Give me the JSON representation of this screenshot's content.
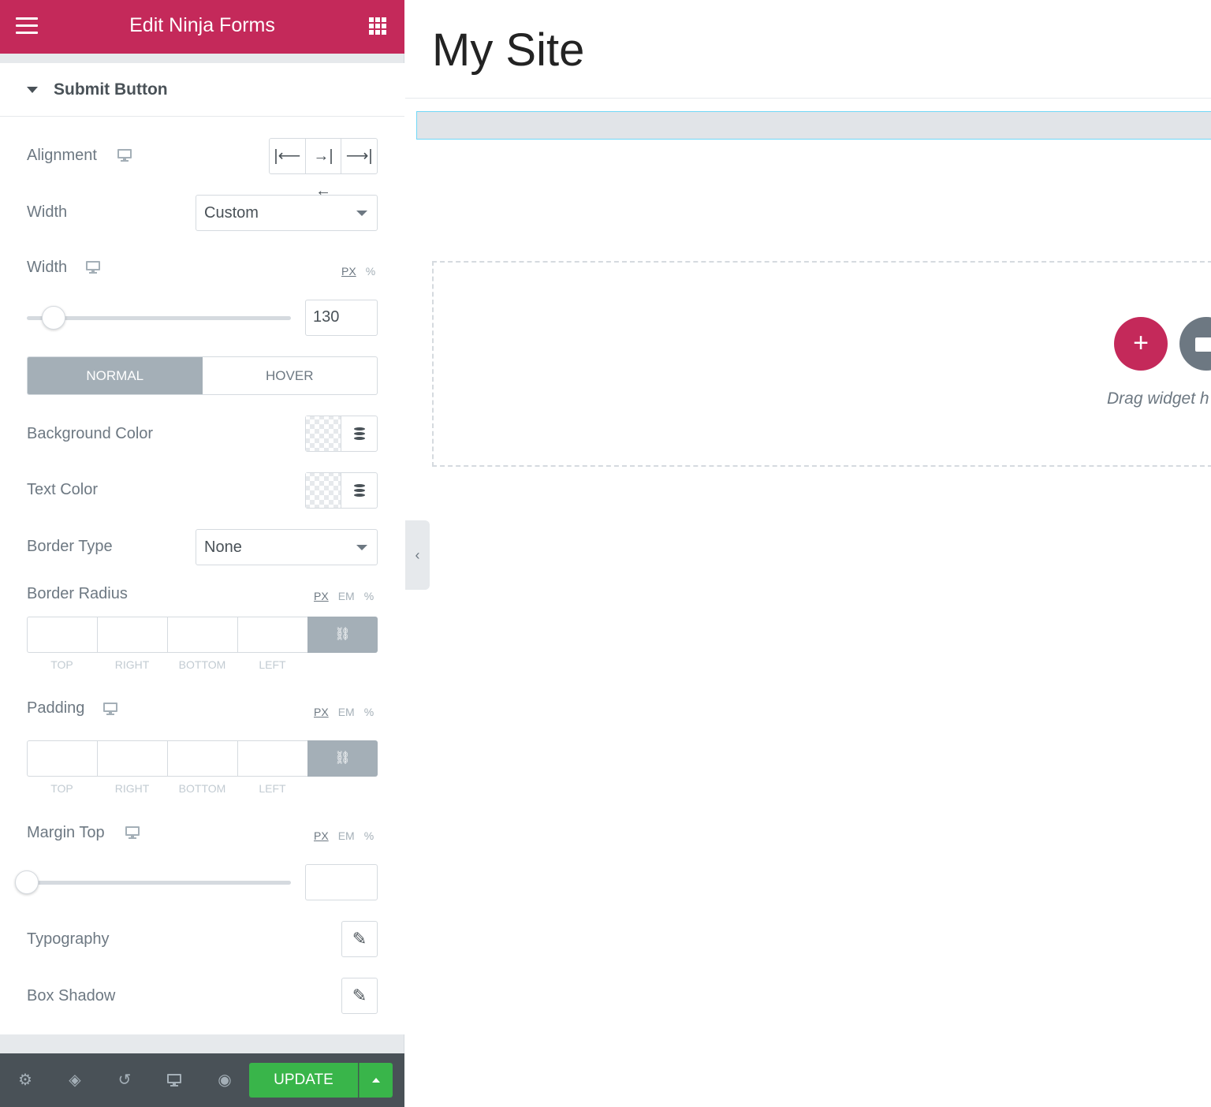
{
  "header": {
    "title": "Edit Ninja Forms"
  },
  "section": {
    "title": "Submit Button"
  },
  "controls": {
    "alignment": {
      "label": "Alignment"
    },
    "width_type": {
      "label": "Width",
      "value": "Custom"
    },
    "width_size": {
      "label": "Width",
      "units": [
        "PX",
        "%"
      ],
      "active_unit": "PX",
      "value": "130",
      "slider_fraction": 0.1
    },
    "state_tabs": {
      "normal": "NORMAL",
      "hover": "HOVER",
      "active": "NORMAL"
    },
    "background_color": {
      "label": "Background Color"
    },
    "text_color": {
      "label": "Text Color"
    },
    "border_type": {
      "label": "Border Type",
      "value": "None"
    },
    "border_radius": {
      "label": "Border Radius",
      "units": [
        "PX",
        "EM",
        "%"
      ],
      "active_unit": "PX",
      "sides": [
        "TOP",
        "RIGHT",
        "BOTTOM",
        "LEFT"
      ]
    },
    "padding": {
      "label": "Padding",
      "units": [
        "PX",
        "EM",
        "%"
      ],
      "active_unit": "PX",
      "sides": [
        "TOP",
        "RIGHT",
        "BOTTOM",
        "LEFT"
      ]
    },
    "margin_top": {
      "label": "Margin Top",
      "units": [
        "PX",
        "EM",
        "%"
      ],
      "active_unit": "PX",
      "value": "",
      "slider_fraction": 0.0
    },
    "typography": {
      "label": "Typography"
    },
    "box_shadow": {
      "label": "Box Shadow"
    }
  },
  "footer": {
    "update_label": "UPDATE",
    "icons": [
      "settings-icon",
      "navigator-icon",
      "history-icon",
      "responsive-icon",
      "preview-icon"
    ]
  },
  "preview": {
    "site_title": "My Site",
    "drag_text": "Drag widget h"
  },
  "colors": {
    "brand": "#c4295a",
    "update": "#39b54a",
    "footer": "#495157",
    "active_tab": "#a4afb7"
  }
}
